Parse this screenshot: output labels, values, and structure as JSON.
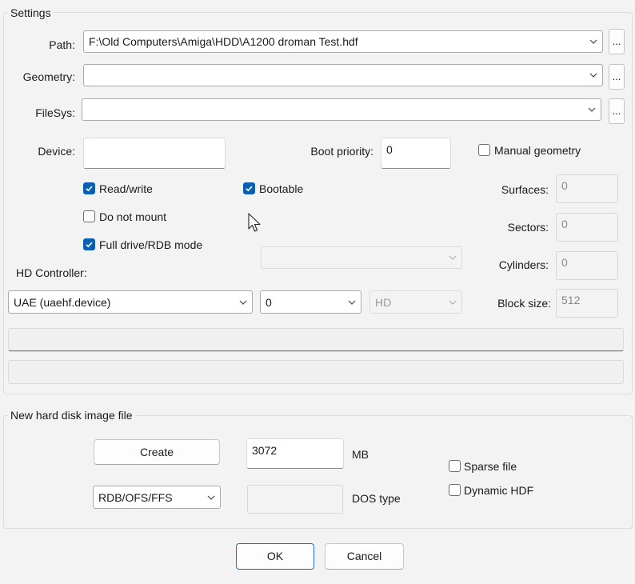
{
  "settings": {
    "title": "Settings",
    "path_label": "Path:",
    "path_value": "F:\\Old Computers\\Amiga\\HDD\\A1200 droman Test.hdf",
    "geometry_label": "Geometry:",
    "geometry_value": "",
    "filesys_label": "FileSys:",
    "filesys_value": "",
    "browse_label": "...",
    "device_label": "Device:",
    "device_value": "",
    "boot_priority_label": "Boot priority:",
    "boot_priority_value": "0",
    "manual_geometry_label": "Manual geometry",
    "read_write_label": "Read/write",
    "bootable_label": "Bootable",
    "do_not_mount_label": "Do not mount",
    "full_drive_label": "Full drive/RDB mode",
    "surfaces_label": "Surfaces:",
    "surfaces_value": "0",
    "sectors_label": "Sectors:",
    "sectors_value": "0",
    "cylinders_label": "Cylinders:",
    "cylinders_value": "0",
    "block_size_label": "Block size:",
    "block_size_value": "512",
    "hd_controller_label": "HD Controller:",
    "controller_value": "UAE (uaehf.device)",
    "unit_value": "0",
    "type_value": "HD",
    "extra_combo_value": ""
  },
  "checkboxes": {
    "manual_geometry": false,
    "read_write": true,
    "bootable": true,
    "do_not_mount": false,
    "full_drive": true,
    "sparse_file": false,
    "dynamic_hdf": false
  },
  "new_image": {
    "title": "New hard disk image file",
    "create_label": "Create",
    "size_value": "3072",
    "size_unit": "MB",
    "sparse_file_label": "Sparse file",
    "dynamic_hdf_label": "Dynamic HDF",
    "fs_value": "RDB/OFS/FFS",
    "dos_type_value": "",
    "dos_type_label": "DOS type"
  },
  "dialog": {
    "ok_label": "OK",
    "cancel_label": "Cancel"
  },
  "colors": {
    "accent": "#0a5fb4",
    "background": "#f3f3f3"
  }
}
